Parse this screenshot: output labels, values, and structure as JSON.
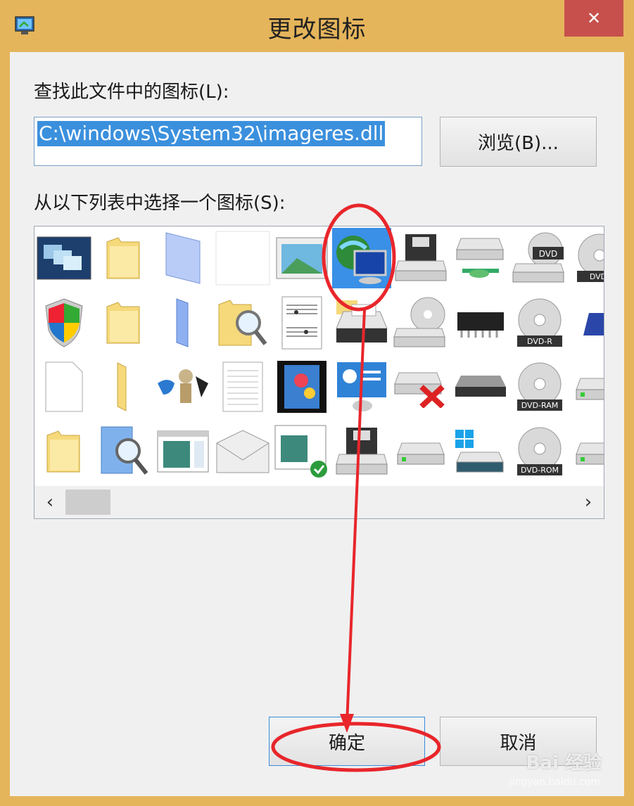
{
  "window": {
    "title": "更改图标",
    "close_glyph": "✕"
  },
  "form": {
    "file_label": "查找此文件中的图标(L):",
    "file_path": "C:\\windows\\System32\\imageres.dll",
    "browse_label": "浏览(B)...",
    "list_label": "从以下列表中选择一个图标(S):"
  },
  "icons": [
    [
      "remote-desktop-icon",
      "folder-icon",
      "blank-doc-blue-icon",
      "blank-icon",
      "picture-window-icon",
      "globe-monitor-icon",
      "floppy-drive-icon",
      "network-drive-icon",
      "dvd-drive-icon",
      "dvd-disc-icon"
    ],
    [
      "security-shield-icon",
      "folder-icon",
      "blue-folder-icon",
      "folder-search-icon",
      "sheet-music-icon",
      "printer-icon",
      "cd-drive-icon",
      "chip-icon",
      "dvd-r-disc-icon",
      "blue-drive-icon"
    ],
    [
      "document-icon",
      "folder-narrow-icon",
      "games-icon",
      "text-document-icon",
      "video-film-icon",
      "presentation-icon",
      "drive-error-icon",
      "removable-drive-icon",
      "dvd-ram-disc-icon",
      "drive-icon"
    ],
    [
      "folder-icon",
      "search-library-icon",
      "window-app-icon",
      "mail-envelope-icon",
      "window-check-icon",
      "floppy-drive-icon",
      "drive-icon",
      "windows-drive-icon",
      "dvd-rom-disc-icon",
      "drive-icon"
    ]
  ],
  "selected_icon": "globe-monitor-icon",
  "disc_labels": {
    "dvd": "DVD",
    "dvd_partial": "DVD-",
    "dvd_r": "DVD-R",
    "dvd_ram": "DVD-RAM",
    "dvd_rom": "DVD-ROM"
  },
  "scroll": {
    "left_arrow": "‹",
    "right_arrow": "›"
  },
  "buttons": {
    "ok_label": "确定",
    "cancel_label": "取消"
  },
  "watermark": {
    "brand": "Bai 经验",
    "url": "jingyan.baidu.com"
  },
  "colors": {
    "title_bar": "#e5b55b",
    "close_button": "#c7504c",
    "selection": "#3a90e6",
    "annotation_red": "#e8262b"
  }
}
